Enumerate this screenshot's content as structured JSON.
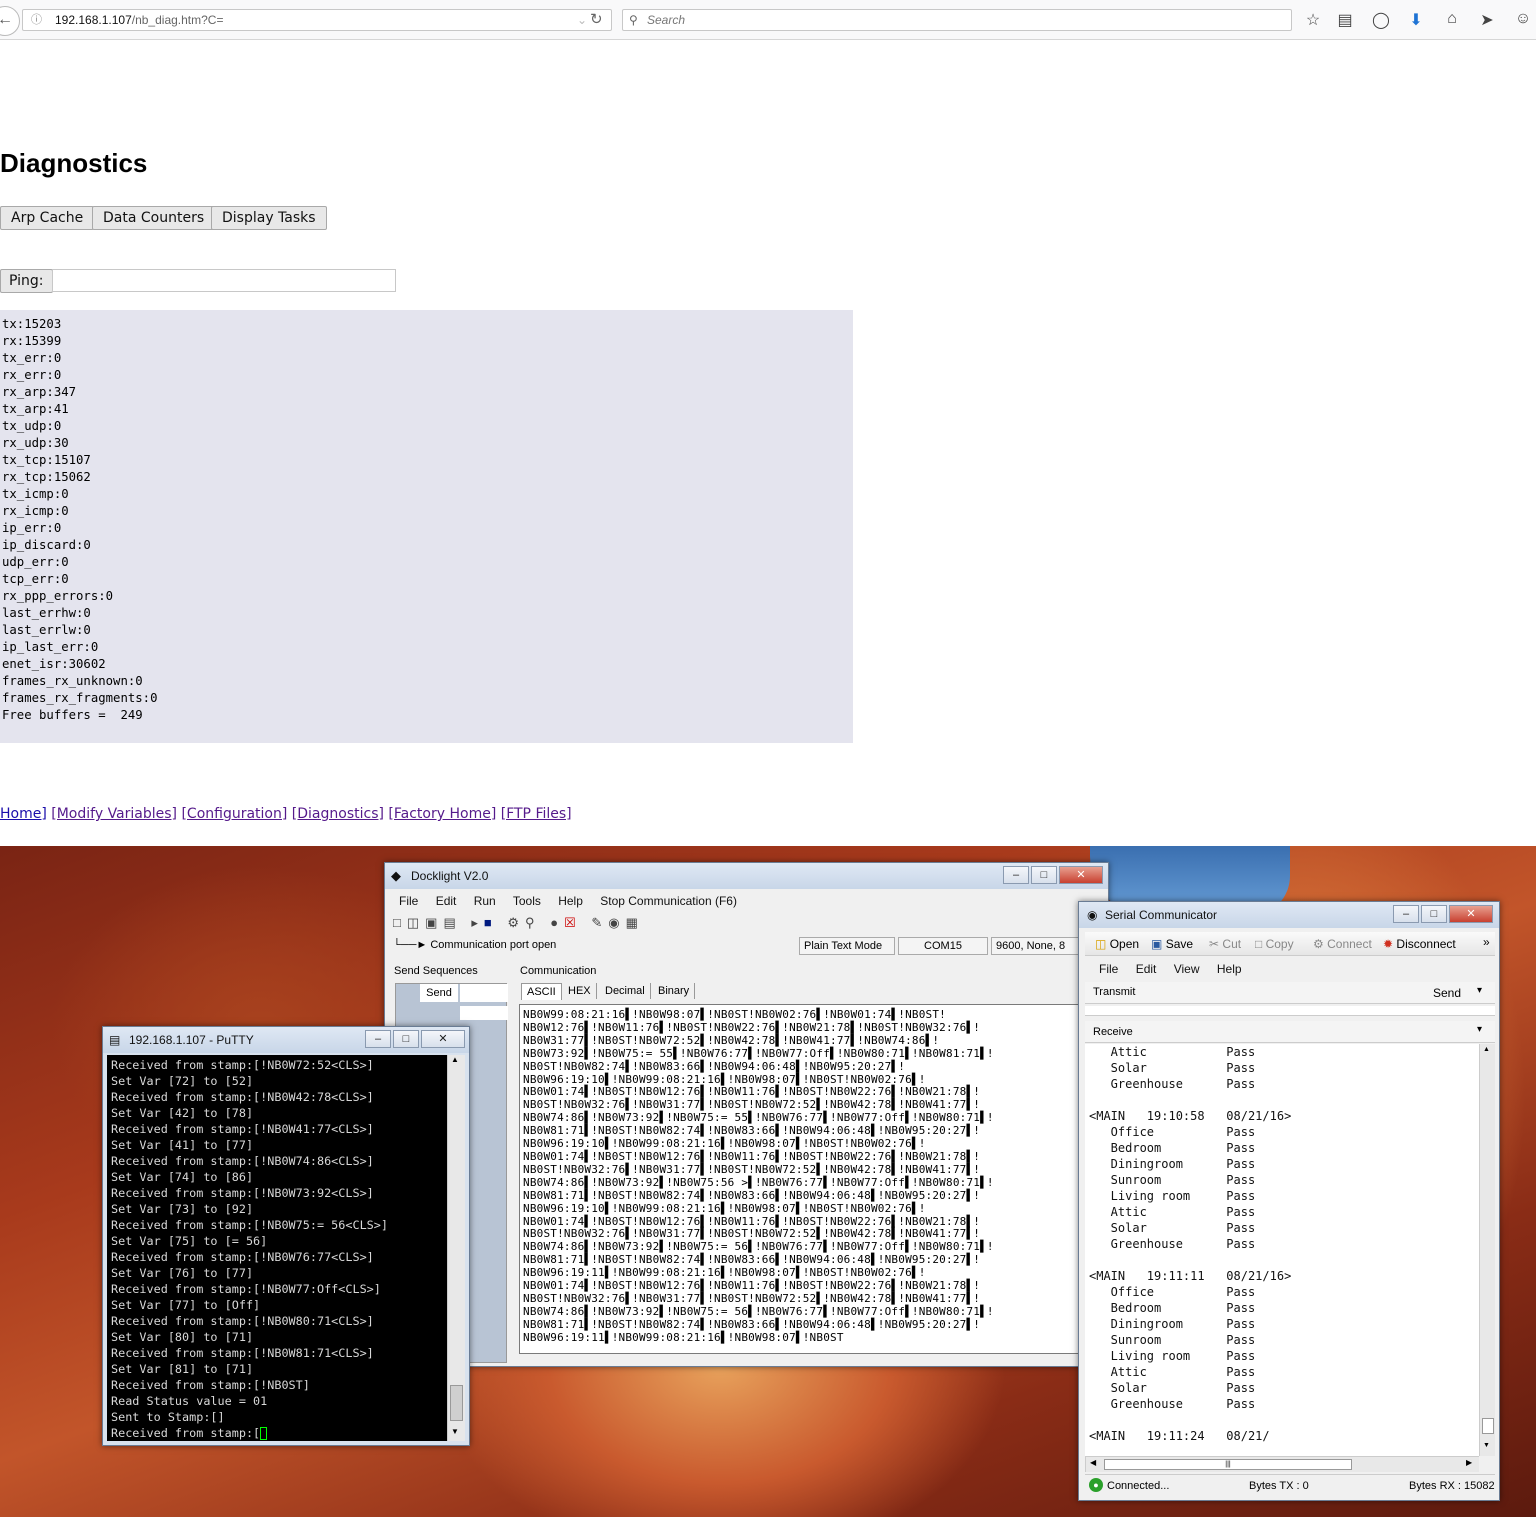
{
  "browser": {
    "url_host": "192.168.1.107",
    "url_path": "/nb_diag.htm?C=",
    "search_placeholder": "Search"
  },
  "page": {
    "title": "Diagnostics",
    "buttons": [
      "Arp Cache",
      "Data Counters",
      "Display Tasks"
    ],
    "ping_label": "Ping:",
    "ping_value": "",
    "diag_output": "tx:15203\nrx:15399\ntx_err:0\nrx_err:0\nrx_arp:347\ntx_arp:41\ntx_udp:0\nrx_udp:30\ntx_tcp:15107\nrx_tcp:15062\ntx_icmp:0\nrx_icmp:0\nip_err:0\nip_discard:0\nudp_err:0\ntcp_err:0\nrx_ppp_errors:0\nlast_errhw:0\nlast_errlw:0\nip_last_err:0\nenet_isr:30602\nframes_rx_unknown:0\nframes_rx_fragments:0\nFree buffers =  249",
    "nav_links": [
      "Home]",
      "[Modify Variables]",
      "[Configuration]",
      "[Diagnostics]",
      "[Factory Home]",
      "[FTP Files]"
    ]
  },
  "docklight": {
    "title": "Docklight V2.0",
    "menu": [
      "File",
      "Edit",
      "Run",
      "Tools",
      "Help",
      "Stop Communication  (F6)"
    ],
    "status_text": "Communication port open",
    "mode": "Plain Text Mode",
    "port": "COM15",
    "settings": "9600, None, 8",
    "send_sequences_label": "Send Sequences",
    "send_button": "Send",
    "communication_label": "Communication",
    "tabs": [
      "ASCII",
      "HEX",
      "Decimal",
      "Binary"
    ],
    "log": "NB0W99:08:21:16▌!NB0W98:07▌!NB0ST!NB0W02:76▌!NB0W01:74▌!NB0ST!\nNB0W12:76▌!NB0W11:76▌!NB0ST!NB0W22:76▌!NB0W21:78▌!NB0ST!NB0W32:76▌!\nNB0W31:77▌!NB0ST!NB0W72:52▌!NB0W42:78▌!NB0W41:77▌!NB0W74:86▌!\nNB0W73:92▌!NB0W75:= 55▌!NB0W76:77▌!NB0W77:Off▌!NB0W80:71▌!NB0W81:71▌!\nNB0ST!NB0W82:74▌!NB0W83:66▌!NB0W94:06:48▌!NB0W95:20:27▌!\nNB0W96:19:10▌!NB0W99:08:21:16▌!NB0W98:07▌!NB0ST!NB0W02:76▌!\nNB0W01:74▌!NB0ST!NB0W12:76▌!NB0W11:76▌!NB0ST!NB0W22:76▌!NB0W21:78▌!\nNB0ST!NB0W32:76▌!NB0W31:77▌!NB0ST!NB0W72:52▌!NB0W42:78▌!NB0W41:77▌!\nNB0W74:86▌!NB0W73:92▌!NB0W75:= 55▌!NB0W76:77▌!NB0W77:Off▌!NB0W80:71▌!\nNB0W81:71▌!NB0ST!NB0W82:74▌!NB0W83:66▌!NB0W94:06:48▌!NB0W95:20:27▌!\nNB0W96:19:10▌!NB0W99:08:21:16▌!NB0W98:07▌!NB0ST!NB0W02:76▌!\nNB0W01:74▌!NB0ST!NB0W12:76▌!NB0W11:76▌!NB0ST!NB0W22:76▌!NB0W21:78▌!\nNB0ST!NB0W32:76▌!NB0W31:77▌!NB0ST!NB0W72:52▌!NB0W42:78▌!NB0W41:77▌!\nNB0W74:86▌!NB0W73:92▌!NB0W75:56 >▌!NB0W76:77▌!NB0W77:Off▌!NB0W80:71▌!\nNB0W81:71▌!NB0ST!NB0W82:74▌!NB0W83:66▌!NB0W94:06:48▌!NB0W95:20:27▌!\nNB0W96:19:10▌!NB0W99:08:21:16▌!NB0W98:07▌!NB0ST!NB0W02:76▌!\nNB0W01:74▌!NB0ST!NB0W12:76▌!NB0W11:76▌!NB0ST!NB0W22:76▌!NB0W21:78▌!\nNB0ST!NB0W32:76▌!NB0W31:77▌!NB0ST!NB0W72:52▌!NB0W42:78▌!NB0W41:77▌!\nNB0W74:86▌!NB0W73:92▌!NB0W75:= 56▌!NB0W76:77▌!NB0W77:Off▌!NB0W80:71▌!\nNB0W81:71▌!NB0ST!NB0W82:74▌!NB0W83:66▌!NB0W94:06:48▌!NB0W95:20:27▌!\nNB0W96:19:11▌!NB0W99:08:21:16▌!NB0W98:07▌!NB0ST!NB0W02:76▌!\nNB0W01:74▌!NB0ST!NB0W12:76▌!NB0W11:76▌!NB0ST!NB0W22:76▌!NB0W21:78▌!\nNB0ST!NB0W32:76▌!NB0W31:77▌!NB0ST!NB0W72:52▌!NB0W42:78▌!NB0W41:77▌!\nNB0W74:86▌!NB0W73:92▌!NB0W75:= 56▌!NB0W76:77▌!NB0W77:Off▌!NB0W80:71▌!\nNB0W81:71▌!NB0ST!NB0W82:74▌!NB0W83:66▌!NB0W94:06:48▌!NB0W95:20:27▌!\nNB0W96:19:11▌!NB0W99:08:21:16▌!NB0W98:07▌!NB0ST"
  },
  "putty": {
    "title": "192.168.1.107 - PuTTY",
    "log": "Received from stamp:[!NB0W72:52<CLS>]\nSet Var [72] to [52]\nReceived from stamp:[!NB0W42:78<CLS>]\nSet Var [42] to [78]\nReceived from stamp:[!NB0W41:77<CLS>]\nSet Var [41] to [77]\nReceived from stamp:[!NB0W74:86<CLS>]\nSet Var [74] to [86]\nReceived from stamp:[!NB0W73:92<CLS>]\nSet Var [73] to [92]\nReceived from stamp:[!NB0W75:= 56<CLS>]\nSet Var [75] to [= 56]\nReceived from stamp:[!NB0W76:77<CLS>]\nSet Var [76] to [77]\nReceived from stamp:[!NB0W77:Off<CLS>]\nSet Var [77] to [Off]\nReceived from stamp:[!NB0W80:71<CLS>]\nSet Var [80] to [71]\nReceived from stamp:[!NB0W81:71<CLS>]\nSet Var [81] to [71]\nReceived from stamp:[!NB0ST]\nRead Status value = 01\nSent to Stamp:[]\nReceived from stamp:["
  },
  "serial": {
    "title": "Serial Communicator",
    "toolbar": [
      "Open",
      "Save",
      "Cut",
      "Copy",
      "Connect",
      "Disconnect"
    ],
    "menu": [
      "File",
      "Edit",
      "View",
      "Help"
    ],
    "transmit_label": "Transmit",
    "send_label": "Send",
    "receive_label": "Receive",
    "log": "   Attic           Pass\n   Solar           Pass\n   Greenhouse      Pass\n\n<MAIN   19:10:58   08/21/16>\n   Office          Pass\n   Bedroom         Pass\n   Diningroom      Pass\n   Sunroom         Pass\n   Living room     Pass\n   Attic           Pass\n   Solar           Pass\n   Greenhouse      Pass\n\n<MAIN   19:11:11   08/21/16>\n   Office          Pass\n   Bedroom         Pass\n   Diningroom      Pass\n   Sunroom         Pass\n   Living room     Pass\n   Attic           Pass\n   Solar           Pass\n   Greenhouse      Pass\n\n<MAIN   19:11:24   08/21/",
    "status": "Connected...",
    "bytes_tx": "Bytes TX : 0",
    "bytes_rx": "Bytes RX : 15082"
  }
}
